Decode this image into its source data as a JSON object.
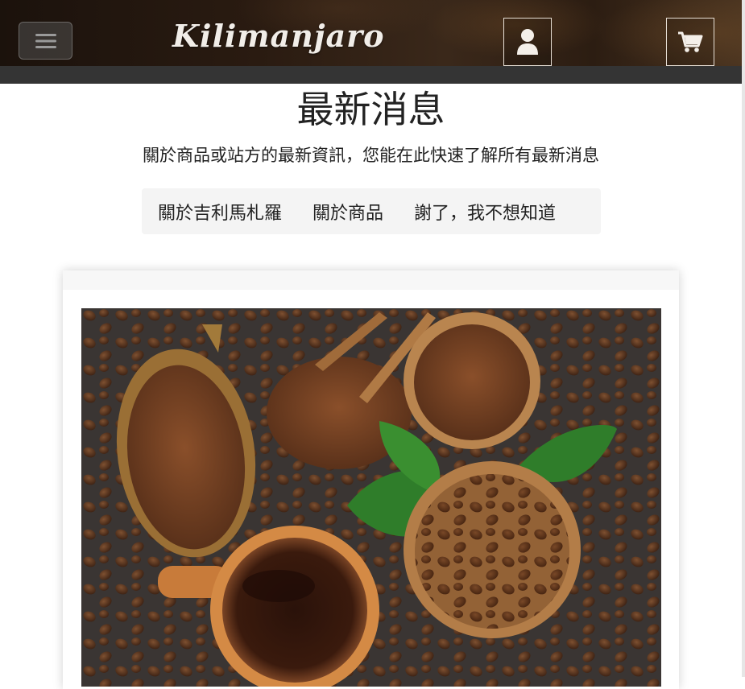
{
  "header": {
    "brand": "Kilimanjaro",
    "menu_icon": "menu-icon",
    "user_icon": "user-icon",
    "cart_icon": "cart-icon",
    "colors": {
      "bar": "#2a1b11",
      "subbar": "#343434"
    }
  },
  "page": {
    "title": "最新消息",
    "subtitle": "關於商品或站方的最新資訊，您能在此快速了解所有最新消息"
  },
  "tabs": [
    {
      "label": "關於吉利馬札羅"
    },
    {
      "label": "關於商品"
    },
    {
      "label": "謝了，我不想知道"
    }
  ],
  "card": {
    "image": "coffee-beans-photo"
  }
}
